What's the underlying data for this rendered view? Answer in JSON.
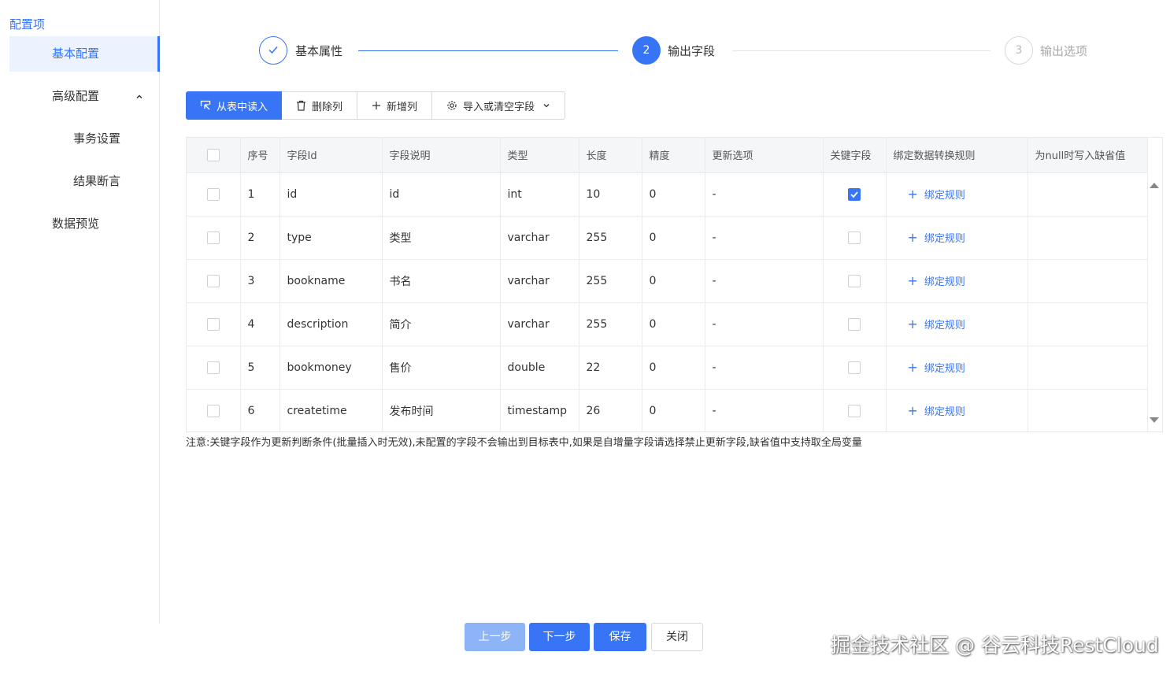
{
  "sidebar": {
    "title": "配置项",
    "items": [
      {
        "label": "基本配置"
      },
      {
        "label": "高级配置"
      },
      {
        "label": "事务设置"
      },
      {
        "label": "结果断言"
      },
      {
        "label": "数据预览"
      }
    ]
  },
  "steps": [
    {
      "label": "基本属性",
      "state": "done"
    },
    {
      "number": "2",
      "label": "输出字段",
      "state": "active"
    },
    {
      "number": "3",
      "label": "输出选项",
      "state": "pending"
    }
  ],
  "toolbar": {
    "read_from_table": "从表中读入",
    "delete_column": "删除列",
    "add_column": "新增列",
    "import_or_clear": "导入或清空字段"
  },
  "table": {
    "headers": [
      "序号",
      "字段Id",
      "字段说明",
      "类型",
      "长度",
      "精度",
      "更新选项",
      "关键字段",
      "绑定数据转换规则",
      "为null时写入缺省值"
    ],
    "rows": [
      {
        "seq": "1",
        "id": "id",
        "desc": "id",
        "type": "int",
        "length": "10",
        "precision": "0",
        "update": "-",
        "key": true,
        "rule": "绑定规则"
      },
      {
        "seq": "2",
        "id": "type",
        "desc": "类型",
        "type": "varchar",
        "length": "255",
        "precision": "0",
        "update": "-",
        "key": false,
        "rule": "绑定规则"
      },
      {
        "seq": "3",
        "id": "bookname",
        "desc": "书名",
        "type": "varchar",
        "length": "255",
        "precision": "0",
        "update": "-",
        "key": false,
        "rule": "绑定规则"
      },
      {
        "seq": "4",
        "id": "description",
        "desc": "简介",
        "type": "varchar",
        "length": "255",
        "precision": "0",
        "update": "-",
        "key": false,
        "rule": "绑定规则"
      },
      {
        "seq": "5",
        "id": "bookmoney",
        "desc": "售价",
        "type": "double",
        "length": "22",
        "precision": "0",
        "update": "-",
        "key": false,
        "rule": "绑定规则"
      },
      {
        "seq": "6",
        "id": "createtime",
        "desc": "发布时间",
        "type": "timestamp",
        "length": "26",
        "precision": "0",
        "update": "-",
        "key": false,
        "rule": "绑定规则"
      }
    ]
  },
  "note": "注意:关键字段作为更新判断条件(批量插入时无效),未配置的字段不会输出到目标表中,如果是自增量字段请选择禁止更新字段,缺省值中支持取全局变量",
  "buttons": {
    "prev": "上一步",
    "next": "下一步",
    "save": "保存",
    "close": "关闭"
  },
  "watermark": "掘金技术社区 @ 谷云科技RestCloud",
  "colors": {
    "accent": "#3875f6",
    "accent_light": "#8eb4f8"
  }
}
